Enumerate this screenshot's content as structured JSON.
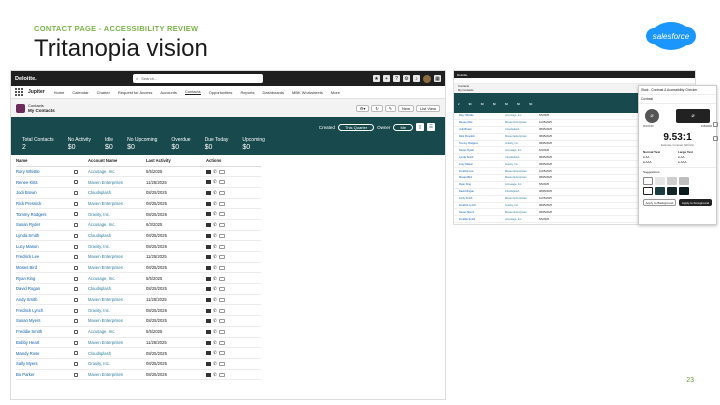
{
  "slide": {
    "eyebrow": "CONTACT PAGE - ACCESSIBILITY REVIEW",
    "title": "Tritanopia vision",
    "logo": "salesforce",
    "page_number": "23"
  },
  "app": {
    "brand": "Deloitte.",
    "search_placeholder": "Search...",
    "app_name": "Jupiter",
    "nav": [
      "Home",
      "Calendar",
      "Charter",
      "Request for Access",
      "Accounts",
      "Contacts",
      "Opportunities",
      "Reports",
      "Dashboards",
      "MBK Worksheets",
      "More"
    ],
    "object_label": "Contacts",
    "list_view": "My Contacts",
    "actions": [
      "New",
      "List View"
    ],
    "filters": {
      "created_label": "Created",
      "created_value": "This Quarter",
      "owner_label": "Owner",
      "owner_value": "Me"
    },
    "metrics": [
      {
        "label": "Total Contacts",
        "value": "2"
      },
      {
        "label": "No Activity",
        "value": "$0"
      },
      {
        "label": "Idle",
        "value": "$0"
      },
      {
        "label": "No Upcoming",
        "value": "$0"
      },
      {
        "label": "Overdue",
        "value": "$0"
      },
      {
        "label": "Due Today",
        "value": "$0"
      },
      {
        "label": "Upcoming",
        "value": "$0"
      }
    ],
    "columns": [
      "Name",
      "Account Name",
      "Last Activity",
      "Actions"
    ],
    "rows": [
      {
        "name": "Rory Whistle",
        "account": "Accusage, Inc.",
        "date": "5/5/2025"
      },
      {
        "name": "Renee Kitts",
        "account": "Maven Enterprises",
        "date": "11/25/2025"
      },
      {
        "name": "Jodi Brown",
        "account": "Cloudsplash",
        "date": "08/25/2025"
      },
      {
        "name": "Rick Presnick",
        "account": "Maven Enterprises",
        "date": "08/25/2025"
      },
      {
        "name": "Tommy Rodgers",
        "account": "Gravity, Inc.",
        "date": "08/25/2025"
      },
      {
        "name": "Susan Ryder",
        "account": "Accusage, Inc.",
        "date": "6/3/2025"
      },
      {
        "name": "Lynda Smith",
        "account": "Cloudsplash",
        "date": "08/25/2025"
      },
      {
        "name": "Lucy Mason",
        "account": "Gravity, Inc.",
        "date": "08/25/2025"
      },
      {
        "name": "Fredrick Lee",
        "account": "Maven Enterprises",
        "date": "11/25/2025"
      },
      {
        "name": "Moses Bird",
        "account": "Maven Enterprises",
        "date": "08/25/2025"
      },
      {
        "name": "Ryan King",
        "account": "Accusage, Inc.",
        "date": "5/5/2025"
      },
      {
        "name": "David Rogan",
        "account": "Cloudsplash",
        "date": "08/25/2025"
      },
      {
        "name": "Andy Smith",
        "account": "Maven Enterprises",
        "date": "11/25/2025"
      },
      {
        "name": "Fredrick Lynch",
        "account": "Gravity, Inc.",
        "date": "08/25/2025"
      },
      {
        "name": "Susan Myers",
        "account": "Maven Enterprises",
        "date": "08/25/2025"
      },
      {
        "name": "Freddie Smith",
        "account": "Accusage, Inc.",
        "date": "5/5/2025"
      },
      {
        "name": "Bobby Heart",
        "account": "Maven Enterprises",
        "date": "11/25/2025"
      },
      {
        "name": "Mandy Rose",
        "account": "Cloudsplash",
        "date": "08/25/2025"
      },
      {
        "name": "Sally Myers",
        "account": "Gravity, Inc.",
        "date": "08/25/2025"
      },
      {
        "name": "Bo Parker",
        "account": "Maven Enterprises",
        "date": "08/25/2025"
      }
    ]
  },
  "panel": {
    "title": "Stark - Contrast & Accessibility Checker",
    "section": "Contrast",
    "fg_label": "#FFFFFF",
    "bg_label": "#1B1B1B",
    "ratio": "9.53:1",
    "ratio_caption": "Estimate Contrast (WCAG)",
    "normal_text": "Normal Text",
    "large_text": "Large Text",
    "aa": "AA",
    "aaa": "AAA",
    "suggestions": "Suggestions",
    "apply_bg": "Apply to Background",
    "apply_fg": "Apply to Foreground"
  },
  "colors": {
    "banner": "#17494d",
    "link": "#0b5cab",
    "eyebrow": "#7ab648",
    "logo": "#1b96ff"
  }
}
